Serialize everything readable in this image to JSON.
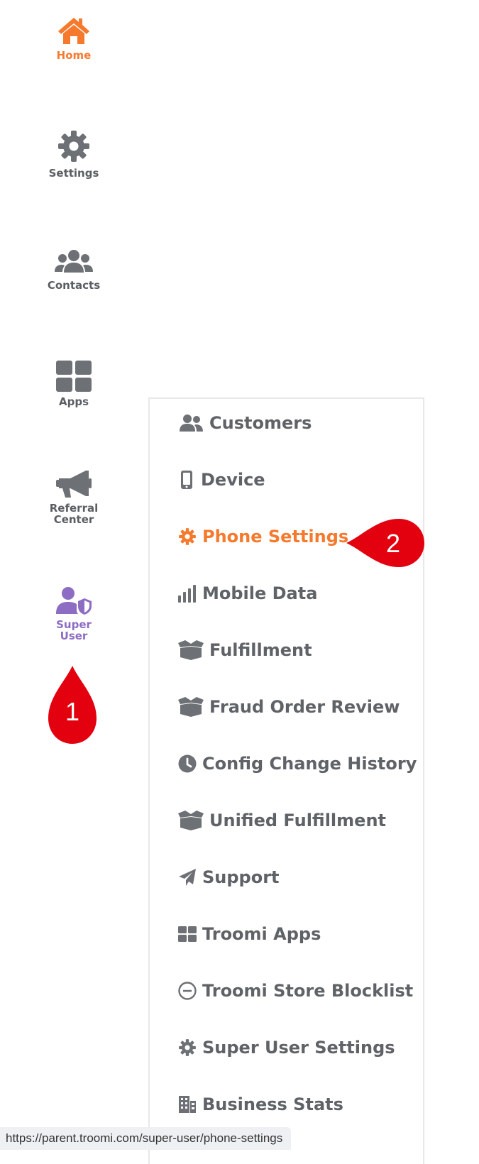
{
  "nav": {
    "items": [
      {
        "label": "Home",
        "icon": "home-icon",
        "active": true
      },
      {
        "label": "Settings",
        "icon": "gear-icon"
      },
      {
        "label": "Contacts",
        "icon": "users-icon"
      },
      {
        "label": "Apps",
        "icon": "apps-grid-icon"
      },
      {
        "label": "Referral\nCenter",
        "icon": "megaphone-icon"
      },
      {
        "label": "Super\nUser",
        "icon": "user-shield-icon"
      }
    ]
  },
  "submenu": {
    "items": [
      {
        "label": "Customers",
        "icon": "users-icon"
      },
      {
        "label": "Device",
        "icon": "mobile-icon"
      },
      {
        "label": "Phone Settings",
        "icon": "gear-icon",
        "active": true
      },
      {
        "label": "Mobile Data",
        "icon": "signal-icon"
      },
      {
        "label": "Fulfillment",
        "icon": "box-icon"
      },
      {
        "label": "Fraud Order Review",
        "icon": "box-icon"
      },
      {
        "label": "Config Change History",
        "icon": "clock-icon"
      },
      {
        "label": "Unified Fulfillment",
        "icon": "box-icon"
      },
      {
        "label": "Support",
        "icon": "paper-plane-icon"
      },
      {
        "label": "Troomi Apps",
        "icon": "apps-grid-icon"
      },
      {
        "label": "Troomi Store Blocklist",
        "icon": "minus-circle-icon"
      },
      {
        "label": "Super User Settings",
        "icon": "gear-icon"
      },
      {
        "label": "Business Stats",
        "icon": "building-icon"
      }
    ]
  },
  "markers": {
    "first": "1",
    "second": "2"
  },
  "statusbar": {
    "url": "https://parent.troomi.com/super-user/phone-settings"
  },
  "colors": {
    "accent": "#f57a2e",
    "icon_gray": "#6d7074",
    "super_user": "#8d6cc3",
    "marker_red": "#e3000f"
  }
}
